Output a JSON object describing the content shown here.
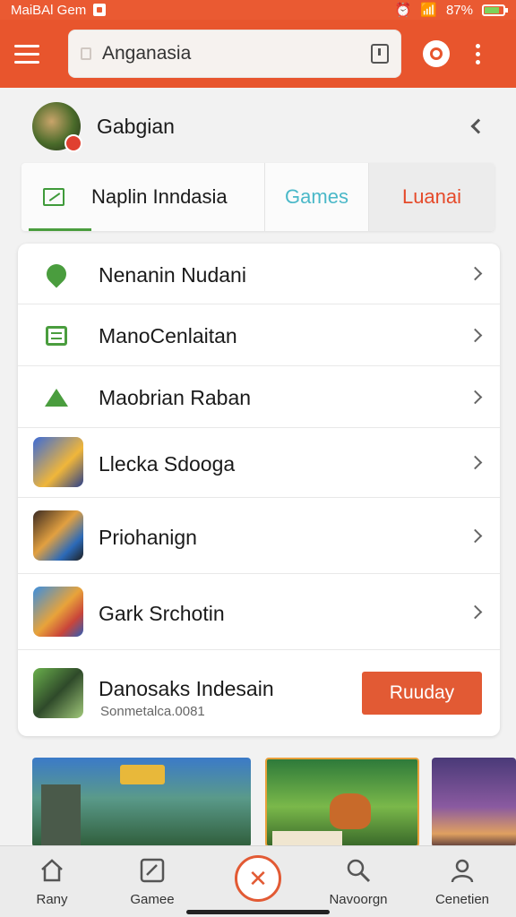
{
  "status_bar": {
    "carrier": "MaiBAl Gem",
    "battery": "87%"
  },
  "app_bar": {
    "search_value": "Anganasia"
  },
  "profile": {
    "name": "Gabgian"
  },
  "tabs": [
    {
      "label": "Naplin Inndasia"
    },
    {
      "label": "Games"
    },
    {
      "label": "Luanai"
    }
  ],
  "list": {
    "items": [
      {
        "label": "Nenanin Nudani",
        "icon": "leaf-icon"
      },
      {
        "label": "ManoCenlaitan",
        "icon": "list-icon"
      },
      {
        "label": "Maobrian Raban",
        "icon": "house-icon"
      },
      {
        "label": "Llecka Sdooga",
        "icon": "game-thumbnail"
      },
      {
        "label": "Priohanign",
        "icon": "game-thumbnail"
      },
      {
        "label": "Gark Srchotin",
        "icon": "game-thumbnail"
      }
    ],
    "featured": {
      "title": "Danosaks Indesain",
      "subtitle": "Sonmetalca.0081",
      "button": "Ruuday"
    }
  },
  "bottom_nav": [
    {
      "label": "Rany",
      "icon": "home-icon"
    },
    {
      "label": "Gamee",
      "icon": "games-icon"
    },
    {
      "label": "Navoorgn",
      "icon": "search-icon"
    },
    {
      "label": "Cenetien",
      "icon": "profile-icon"
    }
  ],
  "colors": {
    "accent": "#e8552d",
    "green": "#4a9d3e",
    "cyan": "#4ab8c8"
  }
}
